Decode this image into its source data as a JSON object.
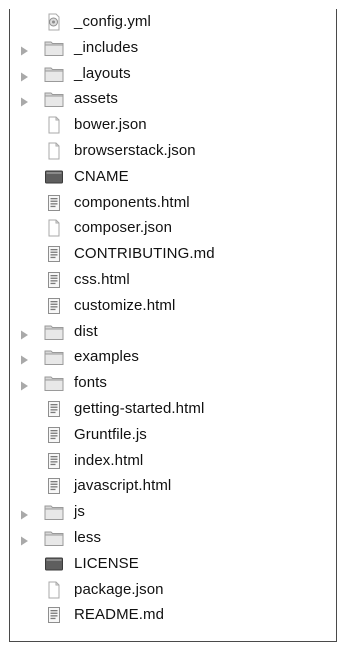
{
  "files": [
    {
      "name": "_config.yml",
      "kind": "yml",
      "expandable": false
    },
    {
      "name": "_includes",
      "kind": "folder",
      "expandable": true
    },
    {
      "name": "_layouts",
      "kind": "folder",
      "expandable": true
    },
    {
      "name": "assets",
      "kind": "folder",
      "expandable": true
    },
    {
      "name": "bower.json",
      "kind": "doc",
      "expandable": false
    },
    {
      "name": "browserstack.json",
      "kind": "doc",
      "expandable": false
    },
    {
      "name": "CNAME",
      "kind": "exec",
      "expandable": false
    },
    {
      "name": "components.html",
      "kind": "text",
      "expandable": false
    },
    {
      "name": "composer.json",
      "kind": "doc",
      "expandable": false
    },
    {
      "name": "CONTRIBUTING.md",
      "kind": "text",
      "expandable": false
    },
    {
      "name": "css.html",
      "kind": "text",
      "expandable": false
    },
    {
      "name": "customize.html",
      "kind": "text",
      "expandable": false
    },
    {
      "name": "dist",
      "kind": "folder",
      "expandable": true
    },
    {
      "name": "examples",
      "kind": "folder",
      "expandable": true
    },
    {
      "name": "fonts",
      "kind": "folder",
      "expandable": true
    },
    {
      "name": "getting-started.html",
      "kind": "text",
      "expandable": false
    },
    {
      "name": "Gruntfile.js",
      "kind": "text",
      "expandable": false
    },
    {
      "name": "index.html",
      "kind": "text",
      "expandable": false
    },
    {
      "name": "javascript.html",
      "kind": "text",
      "expandable": false
    },
    {
      "name": "js",
      "kind": "folder",
      "expandable": true
    },
    {
      "name": "less",
      "kind": "folder",
      "expandable": true
    },
    {
      "name": "LICENSE",
      "kind": "exec",
      "expandable": false
    },
    {
      "name": "package.json",
      "kind": "doc",
      "expandable": false
    },
    {
      "name": "README.md",
      "kind": "text",
      "expandable": false
    }
  ]
}
